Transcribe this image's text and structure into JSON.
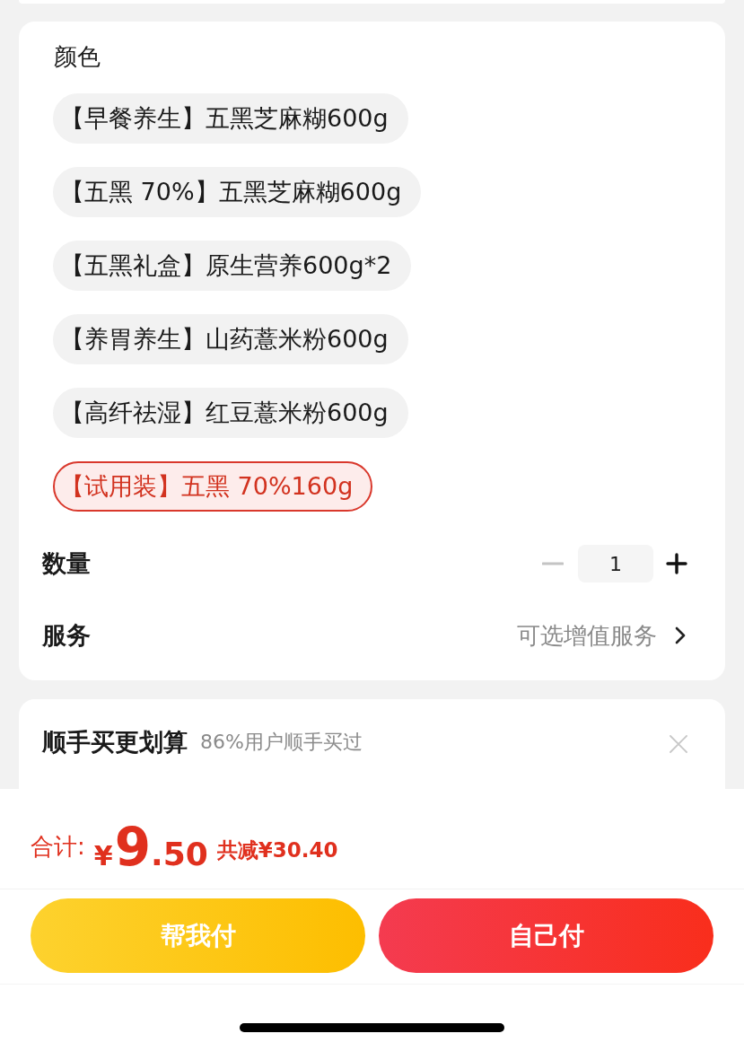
{
  "spec_section": {
    "title": "颜色",
    "options": [
      {
        "label": "【早餐养生】五黑芝麻糊600g",
        "selected": false
      },
      {
        "label": "【五黑 70%】五黑芝麻糊600g",
        "selected": false
      },
      {
        "label": "【五黑礼盒】原生营养600g*2",
        "selected": false
      },
      {
        "label": "【养胃养生】山药薏米粉600g",
        "selected": false
      },
      {
        "label": "【高纤祛湿】红豆薏米粉600g",
        "selected": false
      },
      {
        "label": "【试用装】五黑 70%160g",
        "selected": true
      }
    ]
  },
  "quantity": {
    "label": "数量",
    "value": "1",
    "decrease_disabled": true
  },
  "service": {
    "label": "服务",
    "value": "可选增值服务"
  },
  "bundle": {
    "title": "顺手买更划算",
    "subtitle": "86%用户顺手买过"
  },
  "footer": {
    "total_label": "合计:",
    "currency": "¥",
    "price_integer": "9",
    "price_decimal": ".50",
    "discount": "共减¥30.40",
    "buttons": [
      {
        "label": "帮我付",
        "kind": "secondary"
      },
      {
        "label": "自己付",
        "kind": "primary"
      }
    ]
  }
}
